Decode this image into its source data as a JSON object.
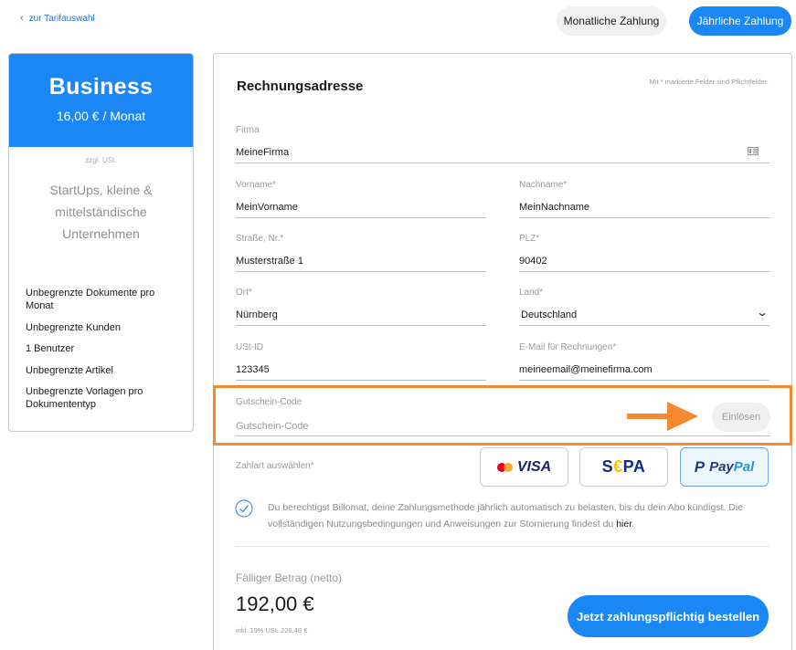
{
  "nav": {
    "back_label": "zur Tarifauswahl"
  },
  "billing_toggle": {
    "monthly_label": "Monatliche Zahlung",
    "yearly_label": "Jährliche Zahlung"
  },
  "plan": {
    "name": "Business",
    "price": "16,00 € / Monat",
    "tax_note": "zzgl. USt.",
    "description": "StartUps, kleine & mittelständische Unternehmen",
    "features": [
      "Unbegrenzte Dokumente pro Monat",
      "Unbegrenzte Kunden",
      "1 Benutzer",
      "Unbegrenzte Artikel",
      "Unbegrenzte Vorlagen pro Dokumententyp"
    ],
    "accent_color": "#1b87f5"
  },
  "form": {
    "title": "Rechnungsadresse",
    "required_note": "Mit * markierte Felder sind Pflichtfelder.",
    "company": {
      "label": "Firma",
      "value": "MeineFirma"
    },
    "first_name": {
      "label": "Vorname*",
      "value": "MeinVorname"
    },
    "last_name": {
      "label": "Nachname*",
      "value": "MeinNachname"
    },
    "street": {
      "label": "Straße, Nr.*",
      "value": "Musterstraße 1"
    },
    "zip": {
      "label": "PLZ*",
      "value": "90402"
    },
    "city": {
      "label": "Ort*",
      "value": "Nürnberg"
    },
    "country": {
      "label": "Land*",
      "value": "Deutschland"
    },
    "vat_id": {
      "label": "USt-ID",
      "value": "123345"
    },
    "invoice_email": {
      "label": "E-Mail für Rechnungen*",
      "value": "meineemail@meinefirma.com"
    }
  },
  "coupon": {
    "label": "Gutschein-Code",
    "placeholder": "Gutschein-Code",
    "value": "",
    "redeem_label": "Einlösen",
    "highlight_color": "#f4892f"
  },
  "payment": {
    "label": "Zahlart auswählen*",
    "options": [
      {
        "id": "visa",
        "label": "VISA",
        "selected": false
      },
      {
        "id": "sepa",
        "label_pre": "S",
        "label_euro": "€",
        "label_post": "PA",
        "selected": false
      },
      {
        "id": "paypal",
        "label_pay": "Pay",
        "label_pal": "Pal",
        "selected": true
      }
    ]
  },
  "consent": {
    "text": "Du berechtigst Billomat, deine Zahlungsmethode jährlich automatisch zu belasten, bis du dein Abo kündigst. Die vollständigen Nutzungsbedingungen und Anweisungen zur Stornierung findest du ",
    "link_label": "hier",
    "suffix": ".",
    "checked": true
  },
  "summary": {
    "due_label": "Fälliger Betrag (netto)",
    "amount": "192,00 €",
    "tax_note": "inkl. 19% USt. 228,48 €",
    "order_label": "Jetzt zahlungspflichtig bestellen"
  }
}
